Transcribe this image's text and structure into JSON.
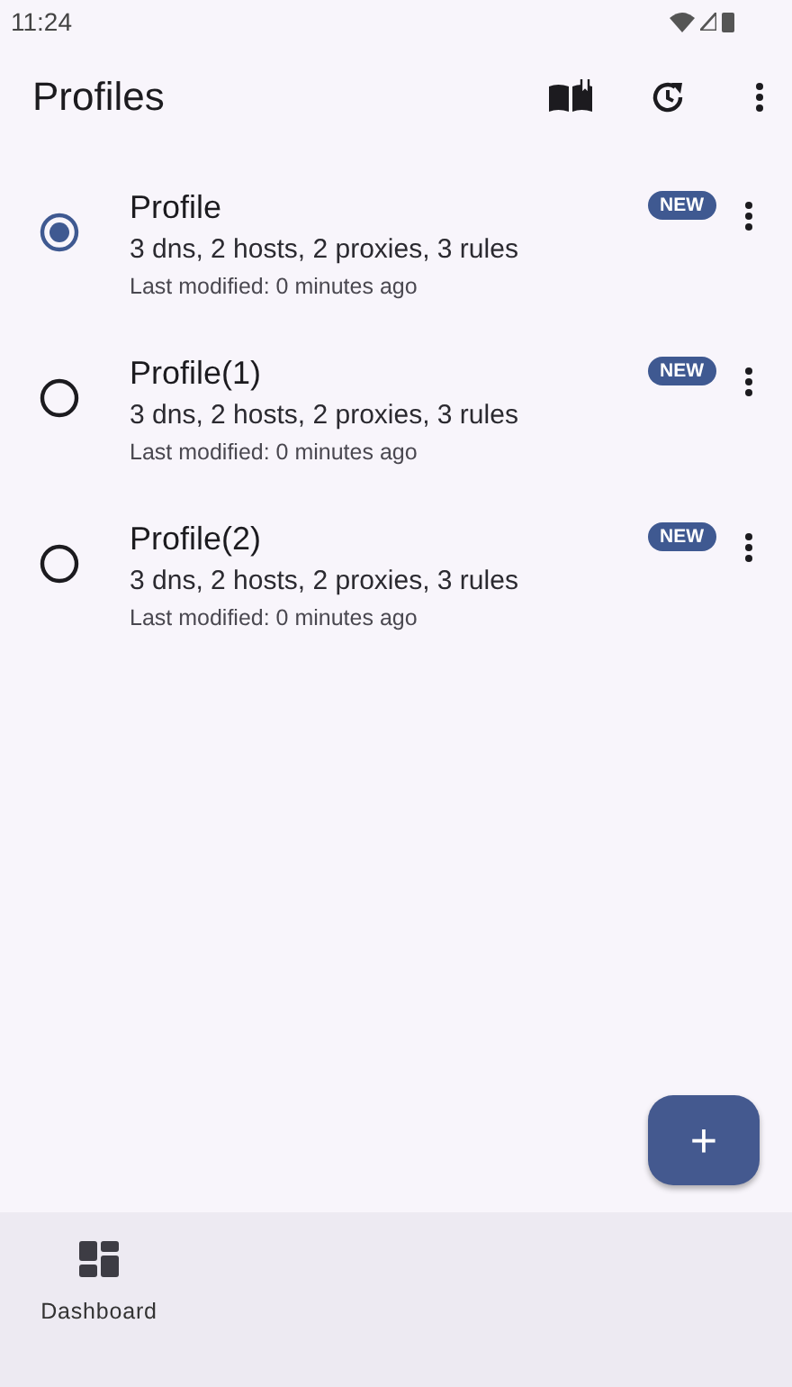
{
  "status_bar": {
    "time": "11:24"
  },
  "app_bar": {
    "title": "Profiles"
  },
  "profiles": [
    {
      "name": "Profile",
      "summary": "3 dns, 2 hosts, 2 proxies, 3 rules",
      "modified": "Last modified: 0 minutes ago",
      "badge": "NEW",
      "selected": true
    },
    {
      "name": "Profile(1)",
      "summary": "3 dns, 2 hosts, 2 proxies, 3 rules",
      "modified": "Last modified: 0 minutes ago",
      "badge": "NEW",
      "selected": false
    },
    {
      "name": "Profile(2)",
      "summary": "3 dns, 2 hosts, 2 proxies, 3 rules",
      "modified": "Last modified: 0 minutes ago",
      "badge": "NEW",
      "selected": false
    }
  ],
  "fab": {
    "label": "+"
  },
  "nav": [
    {
      "label": "Dashboard",
      "selected": false
    }
  ]
}
